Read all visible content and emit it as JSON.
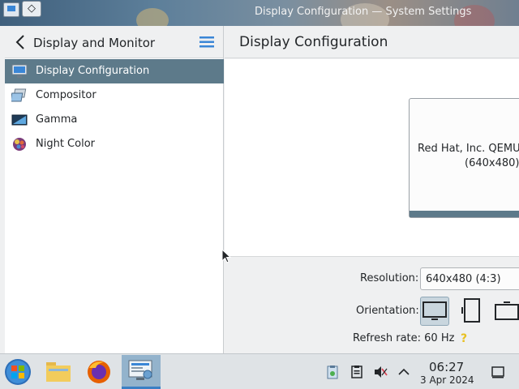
{
  "window": {
    "title": "Display Configuration — System Settings"
  },
  "sidebar": {
    "title": "Display and Monitor",
    "items": [
      {
        "label": "Display Configuration",
        "icon": "monitor-icon",
        "active": true
      },
      {
        "label": "Compositor",
        "icon": "compositor-icon",
        "active": false
      },
      {
        "label": "Gamma",
        "icon": "gamma-icon",
        "active": false
      },
      {
        "label": "Night Color",
        "icon": "night-color-icon",
        "active": false
      }
    ]
  },
  "main": {
    "title": "Display Configuration",
    "monitor": {
      "name": "Red Hat, Inc. QEMU M",
      "resolution": "(640x480)"
    },
    "settings": {
      "resolution_label": "Resolution:",
      "resolution_value": "640x480 (4:3)",
      "orientation_label": "Orientation:",
      "refresh_label": "Refresh rate: 60 Hz"
    }
  },
  "taskbar": {
    "time": "06:27",
    "date": "3 Apr 2024"
  },
  "colors": {
    "accent": "#5d7a8a",
    "selection": "#3daee9",
    "background": "#eff0f1"
  }
}
